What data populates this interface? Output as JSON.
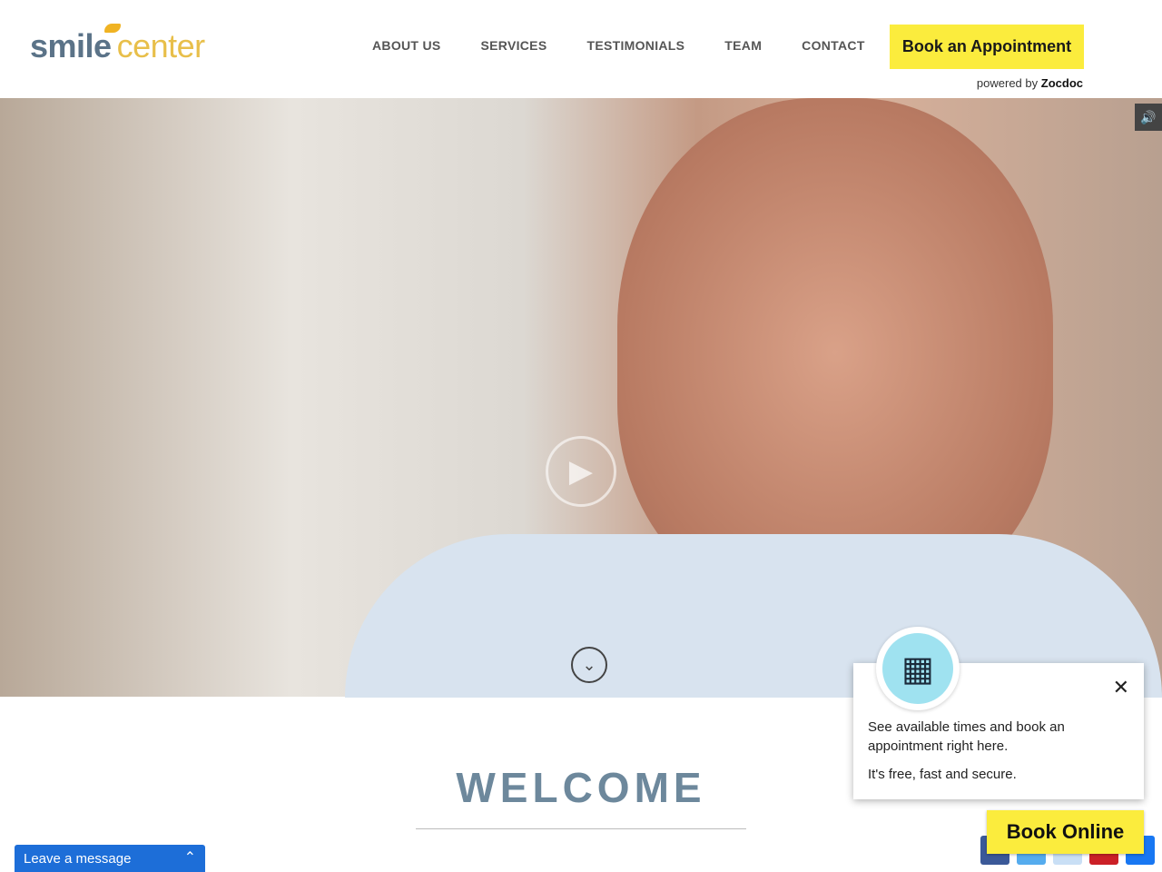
{
  "header": {
    "logo_part1": "smile",
    "logo_part2": "center",
    "nav": [
      "ABOUT US",
      "SERVICES",
      "TESTIMONIALS",
      "TEAM",
      "CONTACT"
    ],
    "book_label": "Book an Appointment",
    "powered_by": "powered by",
    "powered_brand": "Zocdoc"
  },
  "hero": {
    "play_icon": "▶",
    "down_icon": "⌄",
    "sound_icon": "🔊"
  },
  "main": {
    "welcome": "WELCOME"
  },
  "popup": {
    "line1": "See available times and book an appointment right here.",
    "line2": "It's free, fast and secure.",
    "close": "✕",
    "calendar_icon": "▦"
  },
  "book_online": "Book Online",
  "social": {
    "colors": [
      "#3b5998",
      "#55acee",
      "#c9dff5",
      "#cb2027",
      "#1877f2"
    ]
  },
  "chat": {
    "label": "Leave a message",
    "toggle": "⌃"
  }
}
